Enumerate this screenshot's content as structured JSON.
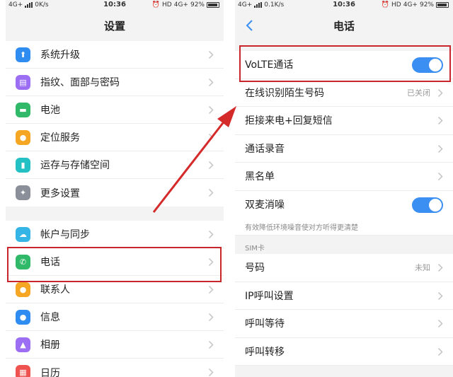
{
  "left": {
    "status": {
      "network": "4G+",
      "speed": "0K/s",
      "time": "10:36",
      "hd": "HD",
      "network2": "4G+",
      "battery": "92%"
    },
    "title": "设置",
    "group1": [
      {
        "label": "系统升级",
        "icon": "system-update-icon",
        "color": "#2f8cf0"
      },
      {
        "label": "指纹、面部与密码",
        "icon": "fingerprint-icon",
        "color": "#9b6ef3"
      },
      {
        "label": "电池",
        "icon": "battery-icon",
        "color": "#2fb968"
      },
      {
        "label": "定位服务",
        "icon": "location-icon",
        "color": "#f5a623"
      },
      {
        "label": "运存与存储空间",
        "icon": "storage-icon",
        "color": "#23c0c4"
      },
      {
        "label": "更多设置",
        "icon": "wrench-icon",
        "color": "#8a8f99"
      }
    ],
    "group2": [
      {
        "label": "帐户与同步",
        "icon": "cloud-icon",
        "color": "#35b4e6"
      },
      {
        "label": "电话",
        "icon": "phone-icon",
        "color": "#2fb968"
      },
      {
        "label": "联系人",
        "icon": "contacts-icon",
        "color": "#f5a623"
      },
      {
        "label": "信息",
        "icon": "message-icon",
        "color": "#2f8cf0"
      },
      {
        "label": "相册",
        "icon": "gallery-icon",
        "color": "#9b6ef3"
      },
      {
        "label": "日历",
        "icon": "calendar-icon",
        "color": "#ef5350"
      }
    ]
  },
  "right": {
    "status": {
      "network": "4G+",
      "speed": "0.1K/s",
      "time": "10:36",
      "hd": "HD",
      "network2": "4G+",
      "battery": "92%"
    },
    "title": "电话",
    "volte": {
      "label": "VoLTE通话",
      "on": true
    },
    "rows1": [
      {
        "label": "在线识别陌生号码",
        "value": "已关闭"
      },
      {
        "label": "拒接来电+回复短信",
        "value": ""
      },
      {
        "label": "通话录音",
        "value": ""
      },
      {
        "label": "黑名单",
        "value": ""
      }
    ],
    "dual_mic": {
      "label": "双麦消噪",
      "on": true,
      "hint": "有效降低环境噪音使对方听得更清楚"
    },
    "sim_section": "SIM卡",
    "rows2": [
      {
        "label": "号码",
        "value": "未知"
      },
      {
        "label": "IP呼叫设置",
        "value": ""
      },
      {
        "label": "呼叫等待",
        "value": ""
      },
      {
        "label": "呼叫转移",
        "value": ""
      }
    ]
  },
  "accent_color": "#3b8ff2",
  "highlight_color": "#c9262b"
}
